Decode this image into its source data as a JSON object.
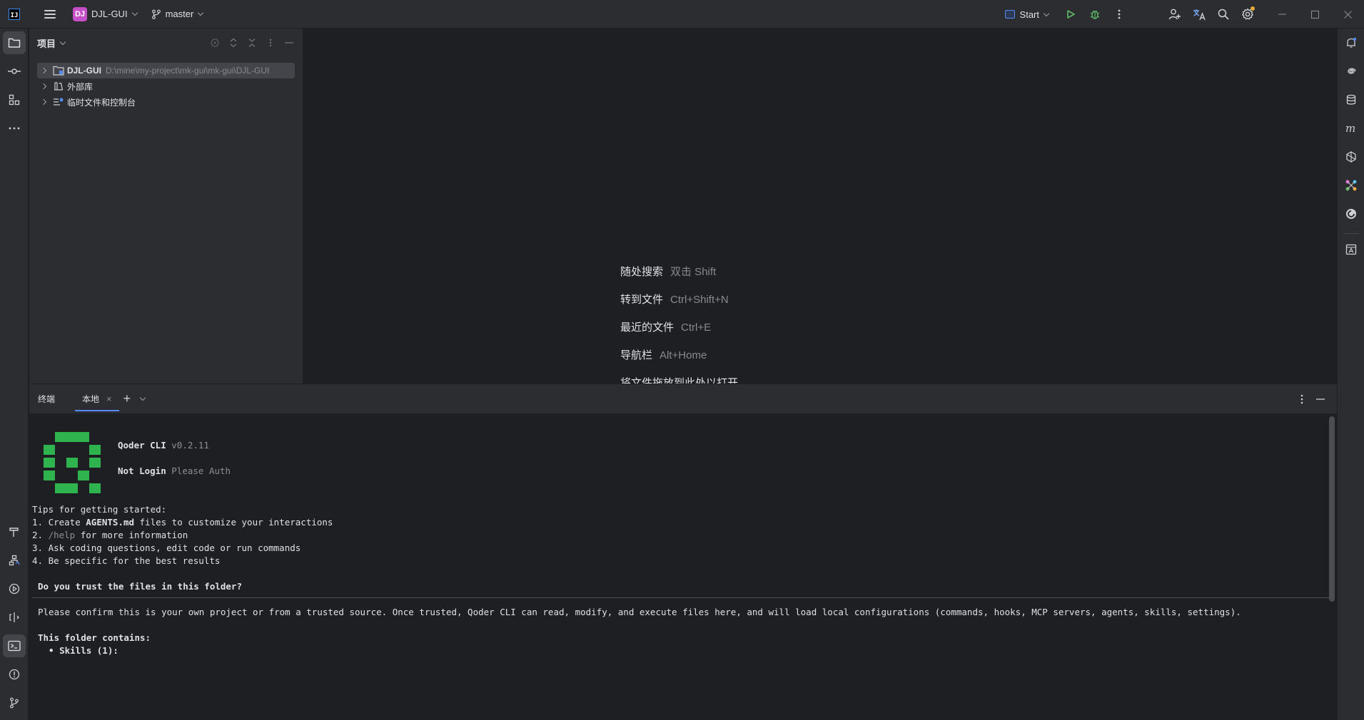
{
  "titlebar": {
    "project_badge": "DJ",
    "project_name": "DJL-GUI",
    "branch": "master",
    "run_config": "Start"
  },
  "project_panel": {
    "title": "项目",
    "tree": [
      {
        "label": "DJL-GUI",
        "path": "D:\\mine\\my-project\\mk-gui\\mk-gui\\DJL-GUI",
        "icon": "module-folder-icon"
      },
      {
        "label": "外部库",
        "icon": "library-icon"
      },
      {
        "label": "临时文件和控制台",
        "icon": "scratch-icon"
      }
    ]
  },
  "editor_hints": [
    {
      "label": "随处搜索",
      "shortcut": "双击 Shift"
    },
    {
      "label": "转到文件",
      "shortcut": "Ctrl+Shift+N"
    },
    {
      "label": "最近的文件",
      "shortcut": "Ctrl+E"
    },
    {
      "label": "导航栏",
      "shortcut": "Alt+Home"
    },
    {
      "label": "将文件拖放到此处以打开",
      "shortcut": ""
    }
  ],
  "terminal": {
    "title": "终端",
    "tab_label": "本地",
    "cli_name": "Qoder CLI",
    "cli_version": "v0.2.11",
    "login_status": "Not Login",
    "login_hint": "Please Auth",
    "tips_header": "Tips for getting started:",
    "tip1_prefix": "1. Create ",
    "tip1_bold": "AGENTS.md",
    "tip1_suffix": " files to customize your interactions",
    "tip2_prefix": "2. ",
    "tip2_dim": "/help",
    "tip2_suffix": " for more information",
    "tip3": "3. Ask coding questions, edit code or run commands",
    "tip4": "4. Be specific for the best results",
    "trust_question": "Do you trust the files in this folder?",
    "trust_body": "Please confirm this is your own project or from a trusted source. Once trusted, Qoder CLI can read, modify, and execute files here, and will load local configurations (commands, hooks, MCP servers, agents, skills, settings).",
    "contains_header": "This folder contains:",
    "contains_item": "  • Skills (1):"
  },
  "colors": {
    "accent": "#548af7",
    "logo_green": "#2fb34e",
    "project_badge": "#c44fc8"
  }
}
